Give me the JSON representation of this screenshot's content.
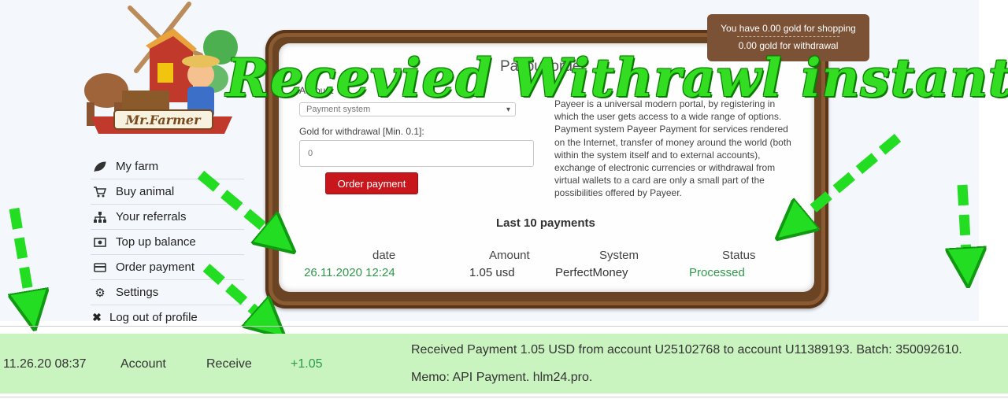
{
  "balance": {
    "shopping": "You have 0.00 gold for shopping",
    "withdrawal": "0.00 gold for withdrawal"
  },
  "logo": {
    "text": "Mr.Farmer"
  },
  "menu": {
    "items": [
      {
        "label": "My farm",
        "icon": "leaf-icon"
      },
      {
        "label": "Buy animal",
        "icon": "cart-icon"
      },
      {
        "label": "Your referrals",
        "icon": "sitemap-icon"
      },
      {
        "label": "Top up balance",
        "icon": "money-icon"
      },
      {
        "label": "Order payment",
        "icon": "credit-card-icon"
      },
      {
        "label": "Settings",
        "icon": "gear-icon"
      },
      {
        "label": "Log out of profile",
        "icon": "close-icon"
      }
    ]
  },
  "board": {
    "title": "Payout order",
    "select_label": "Account",
    "select_value": "Payment system",
    "gold_label": "Gold for withdrawal [Min. 0.1]:",
    "gold_placeholder": "0",
    "order_button": "Order payment",
    "description": "Payeer is a universal modern portal, by registering in which the user gets access to a wide range of options. Payment system Payeer Payment for services rendered on the Internet, transfer of money around the world (both within the system itself and to external accounts), exchange of electronic currencies or withdrawal from virtual wallets to a card are only a small part of the possibilities offered by Payeer.",
    "last_title": "Last 10 payments",
    "table": {
      "headers": [
        "date",
        "Amount",
        "System",
        "Status"
      ],
      "rows": [
        {
          "date": "26.11.2020 12:24",
          "amount": "1.05 usd",
          "system": "PerfectMoney",
          "status": "Processed"
        }
      ]
    }
  },
  "caption": "Recevied Withrawl instant",
  "transaction": {
    "datetime": "11.26.20 08:37",
    "type": "Account",
    "direction": "Receive",
    "amount": "+1.05",
    "memo_line1": "Received Payment 1.05 USD from account U25102768 to account U11389193. Batch: 350092610.",
    "memo_line2": "Memo: API Payment. hlm24.pro."
  },
  "colors": {
    "green_text": "#2e9a4a",
    "order_button": "#c8161d",
    "balance_bg": "#7b5236",
    "board_wood": "#6b4423",
    "tx_bg": "#c9f3bf",
    "caption_green": "#33dd22"
  }
}
